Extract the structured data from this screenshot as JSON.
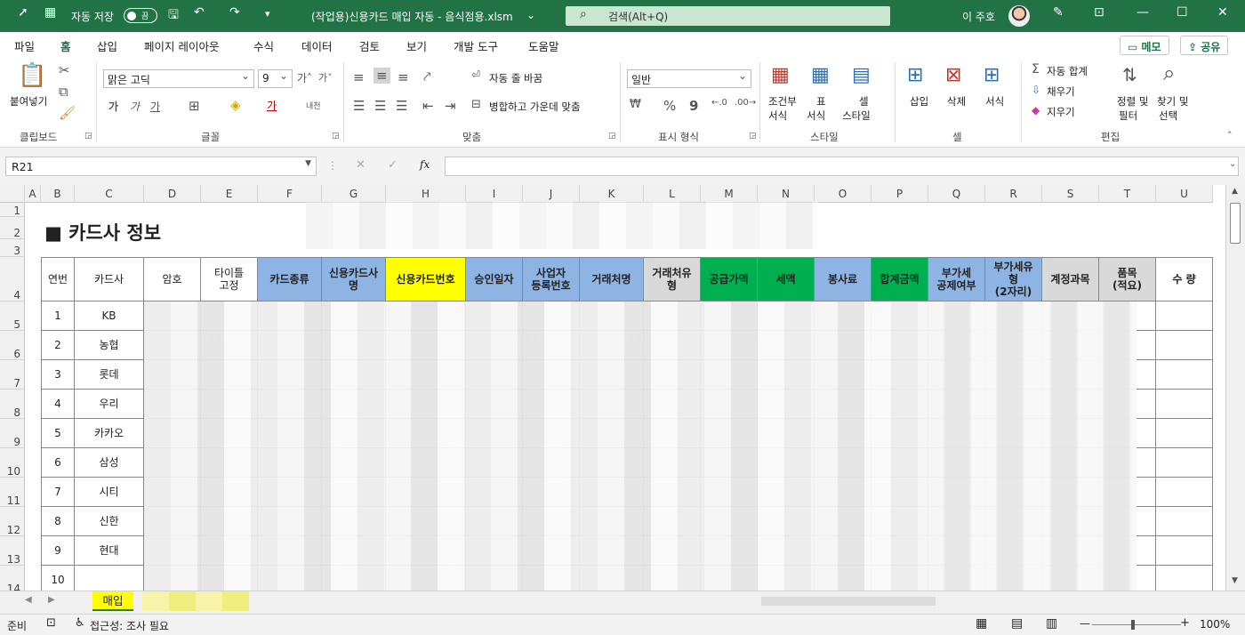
{
  "titlebar": {
    "autosave_label": "자동 저장",
    "autosave_state": "끔",
    "filename": "(작업용)신용카드 매입 자동 - 음식점용.xlsm",
    "search_placeholder": "검색(Alt+Q)",
    "user_name": "이 주호",
    "theme_color": "#217346"
  },
  "menu": {
    "tabs": [
      "파일",
      "홈",
      "삽입",
      "페이지 레이아웃",
      "수식",
      "데이터",
      "검토",
      "보기",
      "개발 도구",
      "도움말"
    ],
    "active_tab": "홈",
    "memo_label": "메모",
    "share_label": "공유"
  },
  "ribbon": {
    "clipboard": {
      "paste": "붙여넣기",
      "label": "클립보드"
    },
    "font": {
      "name": "맑은 고딕",
      "size": "9",
      "bold": "가",
      "italic": "가",
      "underline": "가",
      "font_color": "가",
      "phonetic": "내천",
      "label": "글꼴"
    },
    "align": {
      "wrap": "자동 줄 바꿈",
      "merge": "병합하고 가운데 맞춤",
      "label": "맞춤"
    },
    "number": {
      "format": "일반",
      "percent": "%",
      "comma": "9",
      "label": "표시 형식"
    },
    "styles": {
      "conditional": [
        "조건부",
        "서식"
      ],
      "table": [
        "표",
        "서식"
      ],
      "cell": [
        "셀",
        "스타일"
      ],
      "label": "스타일"
    },
    "cells": {
      "insert": "삽입",
      "delete": "삭제",
      "format": "서식",
      "label": "셀"
    },
    "editing": {
      "autosum": "자동 합계",
      "fill": "채우기",
      "clear": "지우기",
      "sort": [
        "정렬 및",
        "필터"
      ],
      "find": [
        "찾기 및",
        "선택"
      ],
      "label": "편집"
    }
  },
  "formula_bar": {
    "name_box": "R21",
    "fx": "fx",
    "value": ""
  },
  "columns": [
    "A",
    "B",
    "C",
    "D",
    "E",
    "F",
    "G",
    "H",
    "I",
    "J",
    "K",
    "L",
    "M",
    "N",
    "O",
    "P",
    "Q",
    "R",
    "S",
    "T",
    "U"
  ],
  "rows": [
    "1",
    "2",
    "3",
    "4",
    "5",
    "6",
    "7",
    "8",
    "9",
    "10",
    "11",
    "12",
    "13",
    "14"
  ],
  "sheet": {
    "title": "■ 카드사 정보",
    "headers": [
      "연번",
      "카드사",
      "암호",
      "타이틀\n고정",
      "카드종류",
      "신용카드사\n명",
      "신용카드번호",
      "승인일자",
      "사업자\n등록번호",
      "거래처명",
      "거래처유\n형",
      "공급가액",
      "세액",
      "봉사료",
      "합계금액",
      "부가세\n공제여부",
      "부가세유\n형\n(2자리)",
      "계정과목",
      "품목\n(적요)",
      "수 량"
    ],
    "header_colors": [
      "#ffffff",
      "#ffffff",
      "#ffffff",
      "#ffffff",
      "#8eb4e3",
      "#8eb4e3",
      "#ffff00",
      "#8eb4e3",
      "#8eb4e3",
      "#8eb4e3",
      "#d9d9d9",
      "#00b050",
      "#00b050",
      "#8eb4e3",
      "#00b050",
      "#8eb4e3",
      "#8eb4e3",
      "#d9d9d9",
      "#d9d9d9",
      "#ffffff"
    ],
    "numbers": [
      "1",
      "2",
      "3",
      "4",
      "5",
      "6",
      "7",
      "8",
      "9",
      "10"
    ],
    "cards": [
      "KB",
      "농협",
      "롯데",
      "우리",
      "카카오",
      "삼성",
      "시티",
      "신한",
      "현대",
      ""
    ]
  },
  "sheet_tabs": {
    "active": "매입"
  },
  "status": {
    "ready": "준비",
    "accessibility": "접근성: 조사 필요",
    "zoom": "100%"
  }
}
